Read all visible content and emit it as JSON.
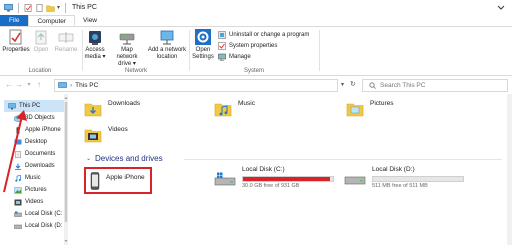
{
  "window": {
    "title": "This PC"
  },
  "ribbon": {
    "tabs": [
      "File",
      "Computer",
      "View"
    ],
    "location": {
      "label": "Location",
      "buttons": [
        "Properties",
        "Open",
        "Rename"
      ]
    },
    "network": {
      "label": "Network",
      "access_media": [
        "Access",
        "media ▾"
      ],
      "map_drive": [
        "Map network",
        "drive ▾"
      ],
      "add_location": [
        "Add a network",
        "location"
      ]
    },
    "system": {
      "label": "System",
      "open_settings": [
        "Open",
        "Settings"
      ],
      "uninstall": "Uninstall or change a program",
      "sys_props": "System properties",
      "manage": "Manage"
    }
  },
  "address": {
    "path": "This PC",
    "search_placeholder": "Search This PC"
  },
  "navpane": {
    "items": [
      "This PC",
      "3D Objects",
      "Apple iPhone",
      "Desktop",
      "Documents",
      "Downloads",
      "Music",
      "Pictures",
      "Videos",
      "Local Disk (C:",
      "Local Disk (D:"
    ]
  },
  "folders": [
    "Downloads",
    "Music",
    "Pictures",
    "Videos"
  ],
  "devices": {
    "heading": "Devices and drives",
    "iphone": "Apple iPhone",
    "drives": [
      {
        "name": "Local Disk (C:)",
        "size": "30.0 GB free of 931 GB",
        "used_fraction": 0.97,
        "color": "#d8232a"
      },
      {
        "name": "Local Disk (D:)",
        "size": "511 MB free of 511 MB",
        "used_fraction": 0.0,
        "color": "#26a0da"
      }
    ]
  },
  "colors": {
    "accent": "#1a6dc6",
    "highlight": "#d8232a",
    "selection": "#cce4f7"
  }
}
